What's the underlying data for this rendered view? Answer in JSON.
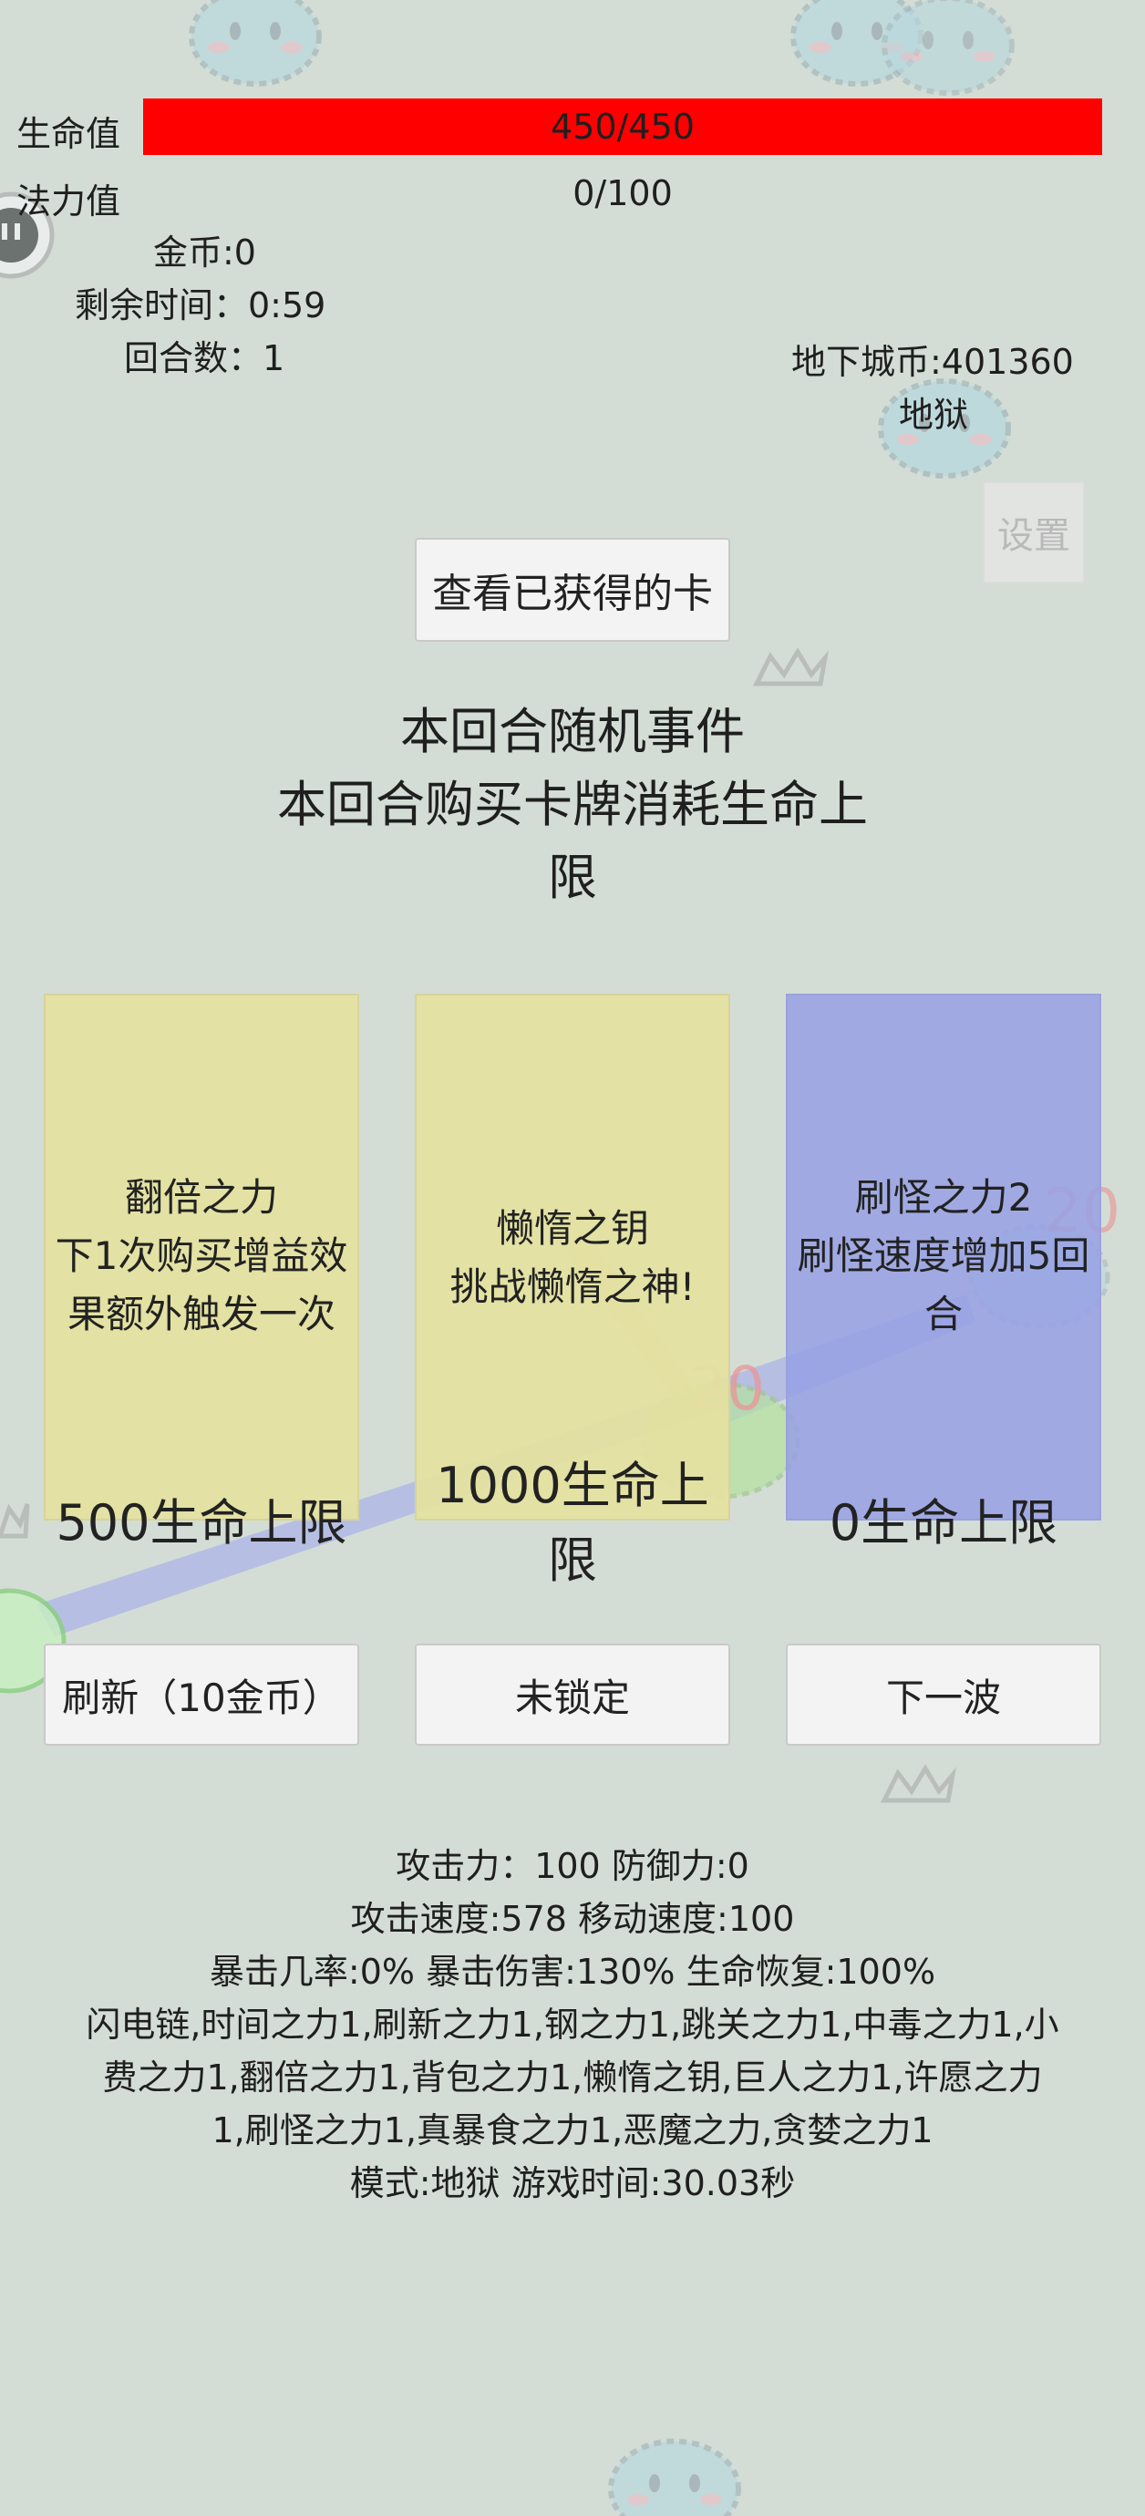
{
  "hud": {
    "hp_label": "生命值",
    "hp_value": "450/450",
    "hp_fill": 1.0,
    "mp_label": "法力值",
    "mp_value": "0/100",
    "gold": "金币:0",
    "time_left": "剩余时间：0:59",
    "round": "回合数：1",
    "dungeon_coins": "地下城币:401360",
    "difficulty": "地狱",
    "settings_label": "设置"
  },
  "view_cards_label": "查看已获得的卡",
  "event": {
    "title": "本回合随机事件",
    "line1": "本回合购买卡牌消耗生命上",
    "line2": "限"
  },
  "cards": [
    {
      "name": "翻倍之力",
      "desc1": "下1次购买增益效",
      "desc2": "果额外触发一次",
      "cost": "500生命上限"
    },
    {
      "name": "懒惰之钥",
      "desc1": "挑战懒惰之神!",
      "desc2": "",
      "cost1": "1000生命上",
      "cost2": "限"
    },
    {
      "name": "刷怪之力2",
      "desc1": "刷怪速度增加5回",
      "desc2": "合",
      "cost": "0生命上限"
    }
  ],
  "buttons": {
    "refresh": "刷新（10金币）",
    "lock": "未锁定",
    "next_wave": "下一波"
  },
  "stats": {
    "line1": "攻击力：100 防御力:0",
    "line2": "攻击速度:578 移动速度:100",
    "line3": "暴击几率:0% 暴击伤害:130% 生命恢复:100%",
    "line4": "闪电链,时间之力1,刷新之力1,钢之力1,跳关之力1,中毒之力1,小",
    "line5": "费之力1,翻倍之力1,背包之力1,懒惰之钥,巨人之力1,许愿之力",
    "line6": "1,刷怪之力1,真暴食之力1,恶魔之力,贪婪之力1",
    "line7": "模式:地狱 游戏时间:30.03秒"
  },
  "enemy_labels": [
    "20",
    "20"
  ],
  "colors": {
    "hp": "#ff0000",
    "card_yellow": "#e4e0a0",
    "card_blue": "#96a0e4",
    "background": "#d3ddd5"
  }
}
